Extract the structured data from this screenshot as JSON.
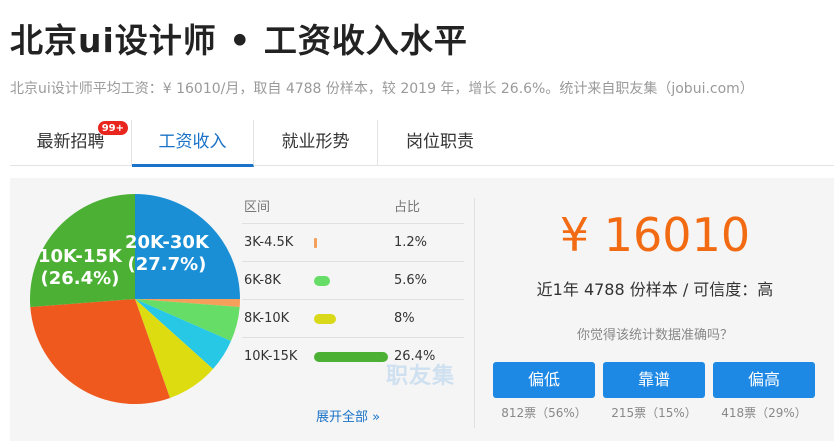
{
  "title": "北京ui设计师 • 工资收入水平",
  "subtitle": "北京ui设计师平均工资：¥ 16010/月，取自 4788 份样本，较 2019 年，增长 26.6%。统计来自职友集（jobui.com）",
  "tabs": [
    {
      "label": "最新招聘",
      "badge": "99+",
      "active": false
    },
    {
      "label": "工资收入",
      "active": true
    },
    {
      "label": "就业形势",
      "active": false
    },
    {
      "label": "岗位职责",
      "active": false
    }
  ],
  "table": {
    "header": {
      "range": "区间",
      "share": "占比"
    },
    "rows": [
      {
        "range": "3K-4.5K",
        "share": "1.2%",
        "value": 1.2,
        "color": "#f5a05a"
      },
      {
        "range": "6K-8K",
        "share": "5.6%",
        "value": 5.6,
        "color": "#66dd66"
      },
      {
        "range": "8K-10K",
        "share": "8%",
        "value": 8,
        "color": "#d9d91a"
      },
      {
        "range": "10K-15K",
        "share": "26.4%",
        "value": 26.4,
        "color": "#4bb034"
      }
    ],
    "expand_label": "展开全部 »"
  },
  "pie_labels": {
    "a_range": "20K-30K",
    "a_pct": "(27.7%)",
    "b_range": "10K-15K",
    "b_pct": "(26.4%)"
  },
  "watermark": "职友集",
  "salary": {
    "amount": "¥ 16010",
    "meta": "近1年 4788 份样本 / 可信度：高",
    "question": "你觉得该统计数据准确吗？"
  },
  "votes": [
    {
      "label": "偏低",
      "count": "812票（56%）"
    },
    {
      "label": "靠谱",
      "count": "215票（15%）"
    },
    {
      "label": "偏高",
      "count": "418票（29%）"
    }
  ],
  "colors": {
    "accent": "#1a73c8",
    "salary": "#f26b12",
    "button": "#1e88e5",
    "badge": "#e8261e"
  }
}
